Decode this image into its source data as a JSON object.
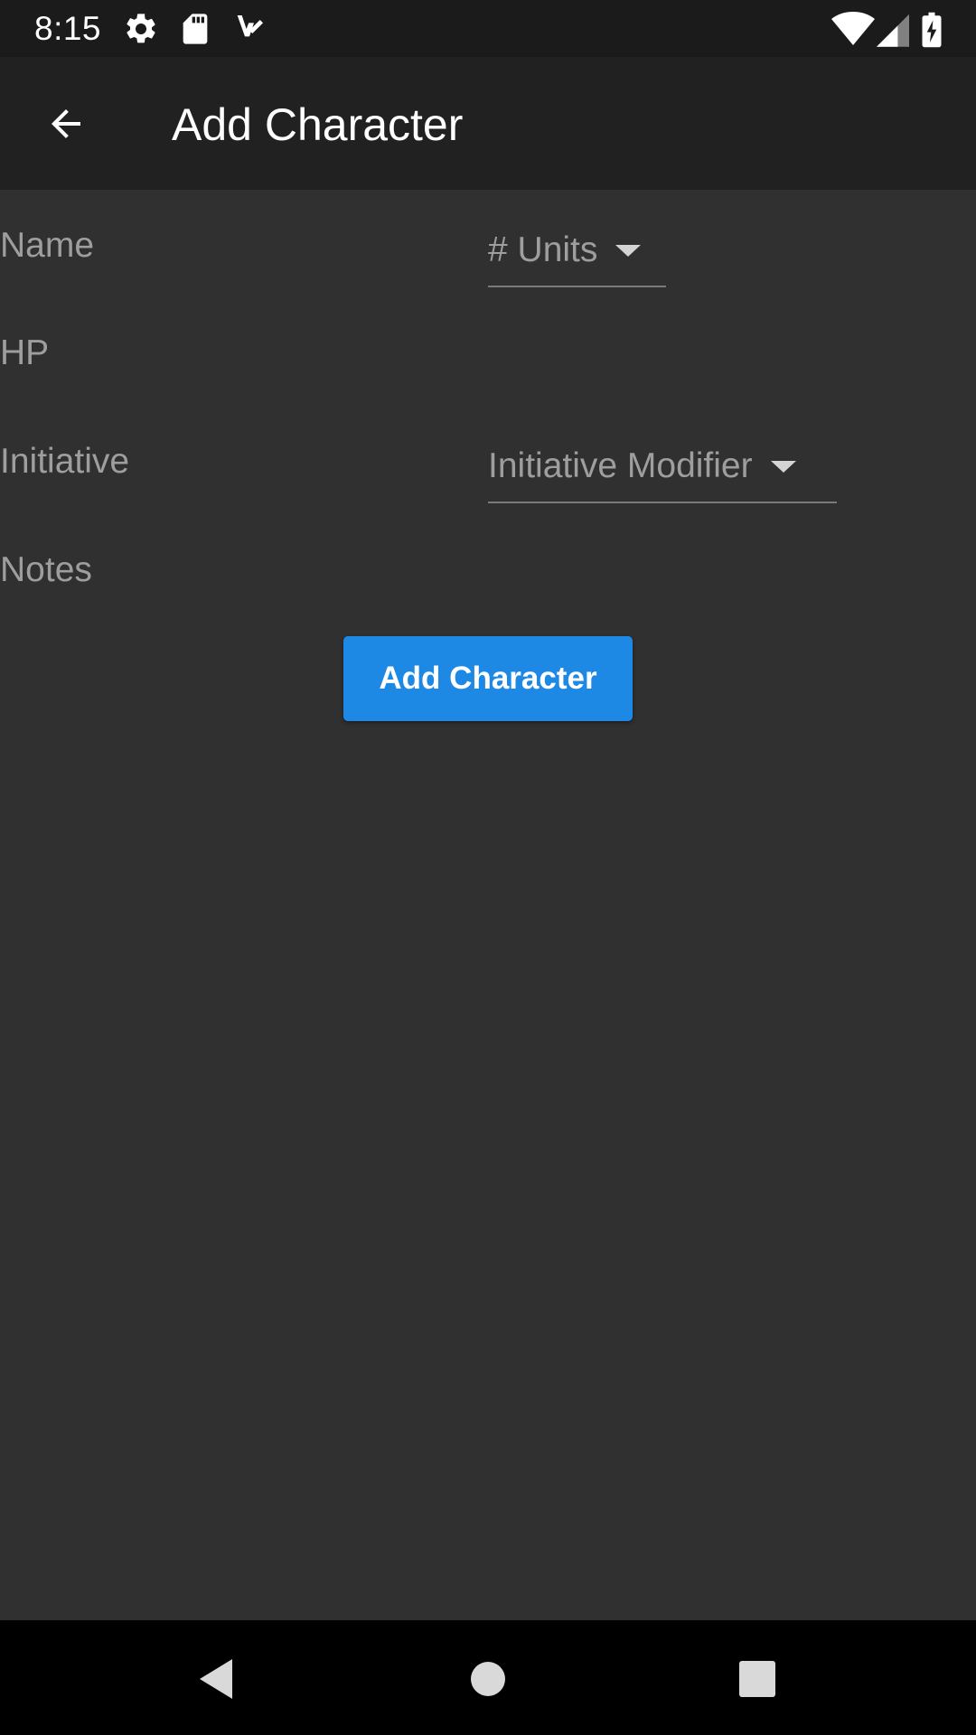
{
  "status_bar": {
    "time": "8:15",
    "left_icons": [
      "gear-icon",
      "sd-card-icon",
      "check-notification-icon"
    ],
    "right_icons": [
      "wifi-icon",
      "cell-signal-icon",
      "battery-charging-icon"
    ]
  },
  "app_bar": {
    "title": "Add Character",
    "back_icon": "arrow-back-icon"
  },
  "form": {
    "name_label": "Name",
    "hp_label": "HP",
    "initiative_label": "Initiative",
    "notes_label": "Notes",
    "units_dropdown": "# Units",
    "initiative_modifier_dropdown": "Initiative Modifier",
    "submit_label": "Add Character"
  },
  "nav_bar": {
    "icons": [
      "back-triangle-icon",
      "home-circle-icon",
      "recents-square-icon"
    ]
  },
  "colors": {
    "background": "#303030",
    "app_bar": "#212121",
    "status_bar": "#1b1b1b",
    "accent": "#1e88e5",
    "label_text": "#9e9e9e"
  }
}
